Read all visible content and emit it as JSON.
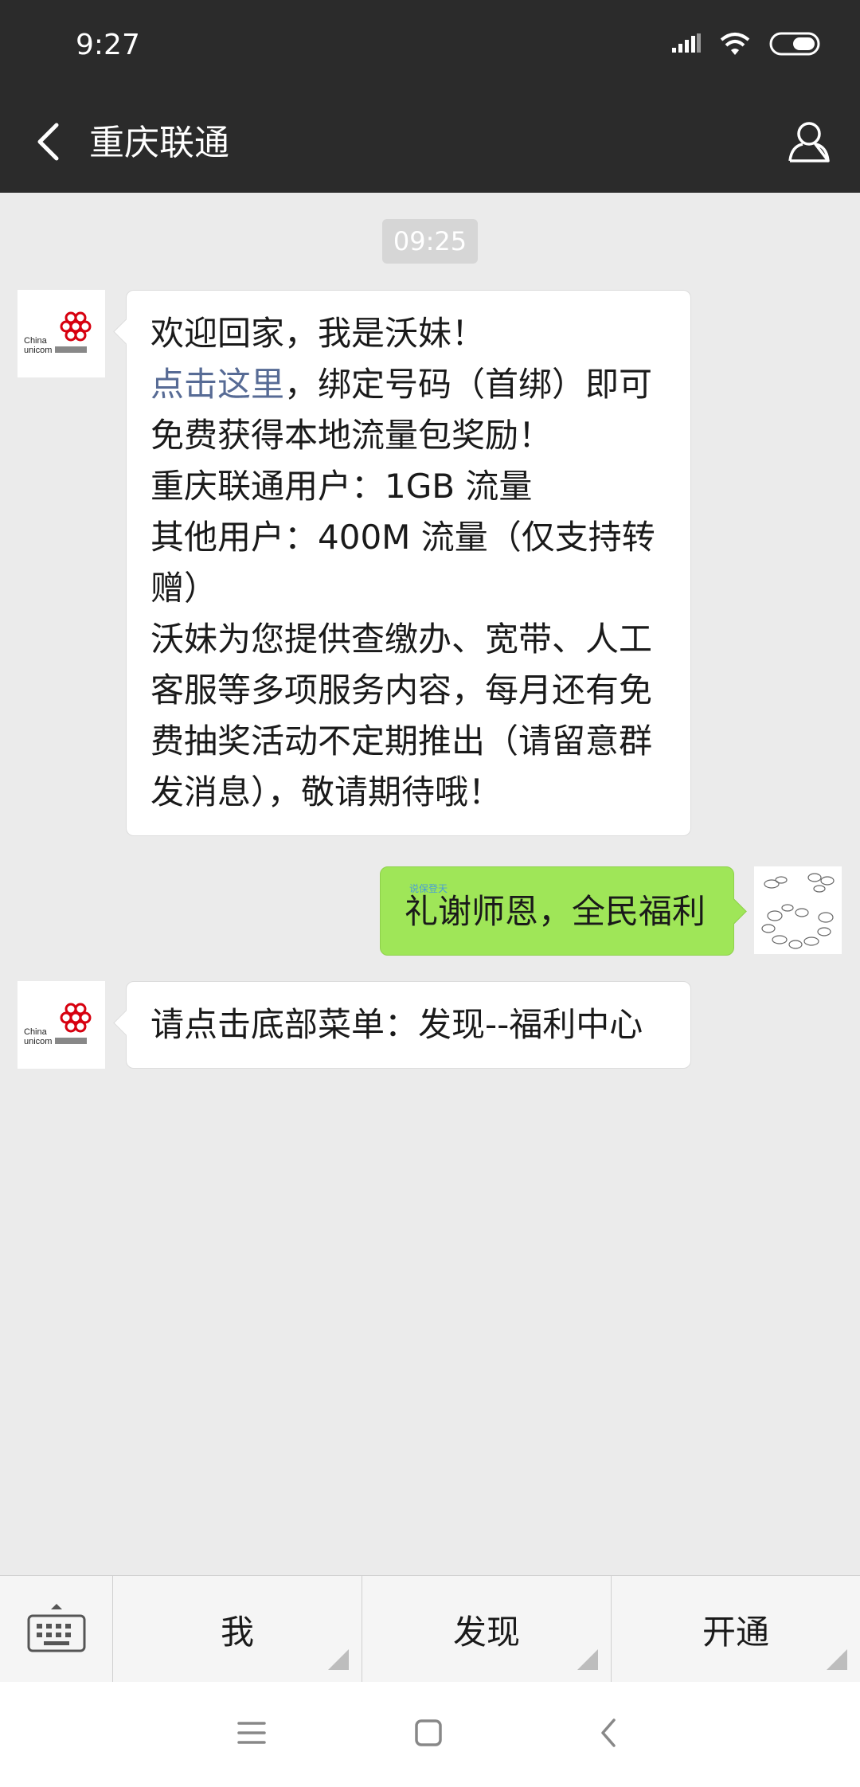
{
  "status_bar": {
    "time": "9:27",
    "icons": [
      "signal-icon",
      "wifi-icon",
      "battery-icon"
    ]
  },
  "nav": {
    "title": "重庆联通",
    "back_icon": "back-arrow-icon",
    "profile_icon": "person-icon"
  },
  "chat": {
    "timestamp": "09:25",
    "messages": [
      {
        "sender": "official",
        "lines": {
          "greeting": "欢迎回家，我是沃妹！",
          "link": "点击这里",
          "after_link": "，绑定号码（首绑）即可免费获得本地流量包奖励！",
          "line_cq": "重庆联通用户：1GB 流量",
          "line_other": "其他用户：400M 流量（仅支持转赠）",
          "line_service": "沃妹为您提供查缴办、宽带、人工客服等多项服务内容，每月还有免费抽奖活动不定期推出（请留意群发消息），敬请期待哦！"
        }
      },
      {
        "sender": "me",
        "text": "礼谢师恩，全民福利",
        "watermark": "说保登天"
      },
      {
        "sender": "official",
        "text": "请点击底部菜单：发现--福利中心"
      }
    ]
  },
  "bottom_menu": {
    "keyboard_icon": "keyboard-icon",
    "items": [
      {
        "label": "我"
      },
      {
        "label": "发现"
      },
      {
        "label": "开通"
      }
    ]
  },
  "system_nav": {
    "icons": [
      "menu-icon",
      "home-icon",
      "back-icon"
    ]
  },
  "colors": {
    "header_bg": "#2b2b2b",
    "chat_bg": "#ebebeb",
    "bubble_me": "#9fe658",
    "link": "#576b95",
    "unicom_red": "#d7000f"
  }
}
